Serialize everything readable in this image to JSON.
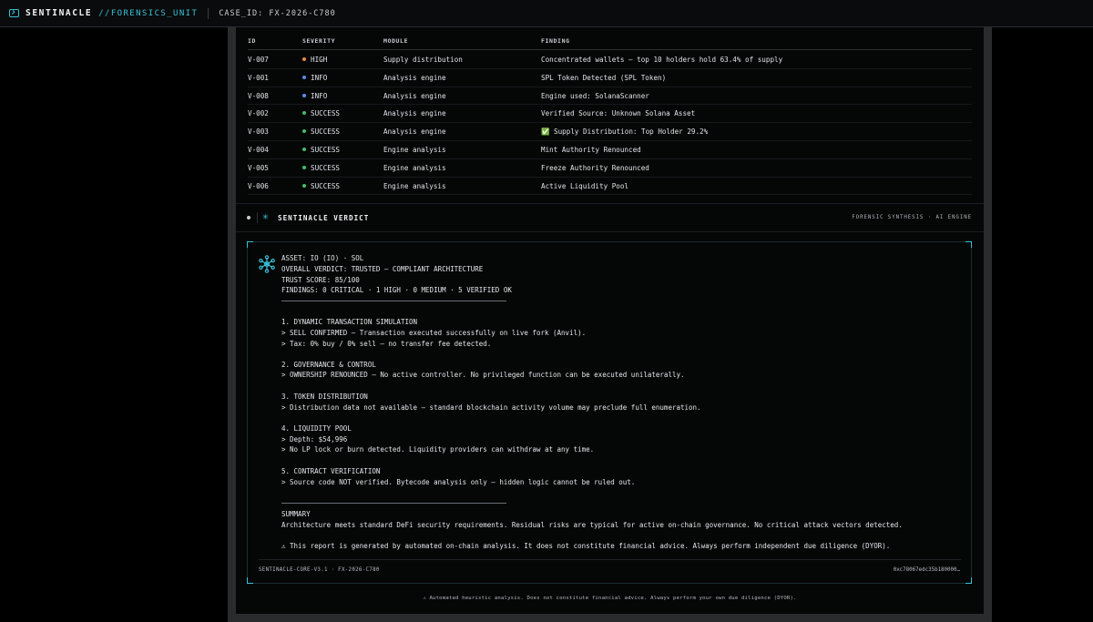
{
  "header": {
    "brand": "SENTINACLE",
    "brand_sub": "//FORENSICS_UNIT",
    "case_id": "CASE_ID: FX-2026-C780",
    "icon": "terminal-icon"
  },
  "table": {
    "columns": [
      "ID",
      "SEVERITY",
      "MODULE",
      "FINDING"
    ],
    "rows": [
      {
        "id": "V-007",
        "severity": "HIGH",
        "module": "Supply distribution",
        "finding": "Concentrated wallets — top 10 holders hold 63.4% of supply"
      },
      {
        "id": "V-001",
        "severity": "INFO",
        "module": "Analysis engine",
        "finding": "SPL Token Detected (SPL Token)"
      },
      {
        "id": "V-008",
        "severity": "INFO",
        "module": "Analysis engine",
        "finding": "Engine used: SolanaScanner"
      },
      {
        "id": "V-002",
        "severity": "SUCCESS",
        "module": "Analysis engine",
        "finding": "Verified Source: Unknown Solana Asset"
      },
      {
        "id": "V-003",
        "severity": "SUCCESS",
        "module": "Analysis engine",
        "finding": "✅ Supply Distribution: Top Holder 29.2%"
      },
      {
        "id": "V-004",
        "severity": "SUCCESS",
        "module": "Engine analysis",
        "finding": "Mint Authority Renounced"
      },
      {
        "id": "V-005",
        "severity": "SUCCESS",
        "module": "Engine analysis",
        "finding": "Freeze Authority Renounced"
      },
      {
        "id": "V-006",
        "severity": "SUCCESS",
        "module": "Engine analysis",
        "finding": "Active Liquidity Pool"
      }
    ]
  },
  "severity_colors": {
    "HIGH": "#e8913a",
    "INFO": "#5b8def",
    "SUCCESS": "#3fbf6a"
  },
  "verdict": {
    "title": "SENTINACLE VERDICT",
    "right_label": "FORENSIC SYNTHESIS · AI ENGINE",
    "icon": "sparkle-icon"
  },
  "report": {
    "asset": "ASSET: IO (IO) · SOL",
    "overall": "OVERALL VERDICT: TRUSTED — COMPLIANT ARCHITECTURE",
    "trust": "TRUST SCORE: 85/100",
    "findings": "FINDINGS: 0 CRITICAL · 1 HIGH · 0 MEDIUM · 5 VERIFIED OK",
    "s1_title": "1. DYNAMIC TRANSACTION SIMULATION",
    "s1_l1": "> SELL CONFIRMED — Transaction executed successfully on live fork (Anvil).",
    "s1_l2": "> Tax: 0% buy / 0% sell — no transfer fee detected.",
    "s2_title": "2. GOVERNANCE & CONTROL",
    "s2_l1": "> OWNERSHIP RENOUNCED — No active controller. No privileged function can be executed unilaterally.",
    "s3_title": "3. TOKEN DISTRIBUTION",
    "s3_l1": "> Distribution data not available — standard blockchain activity volume may preclude full enumeration.",
    "s4_title": "4. LIQUIDITY POOL",
    "s4_l1": "> Depth: $54,996",
    "s4_l2": "> No LP lock or burn detected. Liquidity providers can withdraw at any time.",
    "s5_title": "5. CONTRACT VERIFICATION",
    "s5_l1": "> Source code NOT verified. Bytecode analysis only — hidden logic cannot be ruled out.",
    "summary_title": "SUMMARY",
    "summary_text": "Architecture meets standard DeFi security requirements. Residual risks are typical for active on-chain governance. No critical attack vectors detected.",
    "warning": "⚠ This report is generated by automated on-chain analysis. It does not constitute financial advice. Always perform independent due diligence (DYOR).",
    "footer_left": "SENTINACLE-CORE-V3.1 · FX-2026-C780",
    "footer_right": "0xc78067edc35b180000…",
    "icon": "network-hub-icon"
  },
  "disclaimer": "⚠ Automated heuristic analysis. Does not constitute financial advice. Always perform your own due diligence (DYOR)."
}
